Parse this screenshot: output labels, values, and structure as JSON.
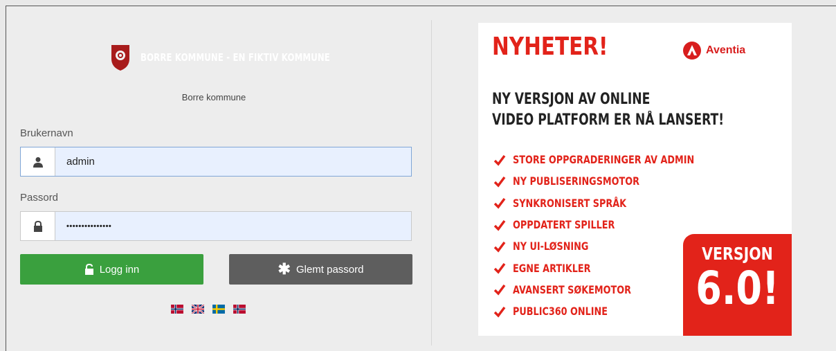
{
  "login": {
    "site_name": "BORRE KOMMUNE - EN FIKTIV KOMMUNE",
    "organization": "Borre kommune",
    "username": {
      "label": "Brukernavn",
      "value": "admin"
    },
    "password": {
      "label": "Passord",
      "value": "•••••••••••••••"
    },
    "login_button": "Logg inn",
    "forgot_button": "Glemt passord",
    "languages": [
      {
        "code": "no",
        "icon": "norway-flag-icon"
      },
      {
        "code": "en",
        "icon": "uk-flag-icon"
      },
      {
        "code": "sv",
        "icon": "sweden-flag-icon"
      },
      {
        "code": "nn",
        "icon": "norway-flag-icon"
      }
    ]
  },
  "ad": {
    "headline": "NYHETER!",
    "brand": "Aventia",
    "subtitle_line1": "NY VERSJON AV ONLINE",
    "subtitle_line2": "VIDEO PLATFORM ER NÅ LANSERT!",
    "features": [
      "STORE OPPGRADERINGER AV ADMIN",
      "NY PUBLISERINGSMOTOR",
      "SYNKRONISERT SPRÅK",
      "OPPDATERT SPILLER",
      "NY UI-LØSNING",
      "EGNE ARTIKLER",
      "AVANSERT SØKEMOTOR",
      "PUBLIC360 ONLINE"
    ],
    "badge_label": "VERSJON",
    "badge_version": "6.0!"
  },
  "colors": {
    "accent_red": "#e2231a",
    "login_green": "#3aa03e",
    "forgot_gray": "#5e5e5e",
    "input_fill": "#e8f0fe"
  }
}
